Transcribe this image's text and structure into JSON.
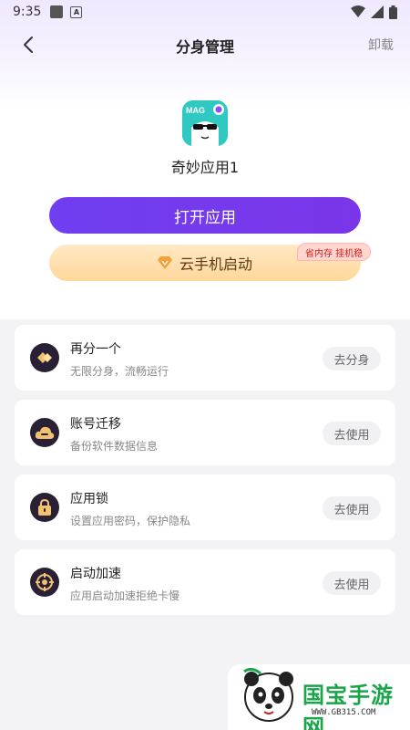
{
  "status_bar": {
    "time": "9:35"
  },
  "nav": {
    "title": "分身管理",
    "right_action": "卸载"
  },
  "app": {
    "name": "奇妙应用1",
    "icon_text": "MAGI"
  },
  "buttons": {
    "open": "打开应用",
    "cloud": "云手机启动",
    "cloud_badge": "省内存 挂机稳"
  },
  "cards": [
    {
      "title": "再分一个",
      "subtitle": "无限分身，流畅运行",
      "action": "去分身"
    },
    {
      "title": "账号迁移",
      "subtitle": "备份软件数据信息",
      "action": "去使用"
    },
    {
      "title": "应用锁",
      "subtitle": "设置应用密码，保护隐私",
      "action": "去使用"
    },
    {
      "title": "启动加速",
      "subtitle": "应用启动加速拒绝卡慢",
      "action": "去使用"
    }
  ],
  "watermark": {
    "text": "国宝手游网",
    "url": "WWW.GB315.COM"
  },
  "colors": {
    "primary": "#7040ee",
    "accent_gold": "#ffd79a",
    "badge_red": "#d0201c"
  }
}
